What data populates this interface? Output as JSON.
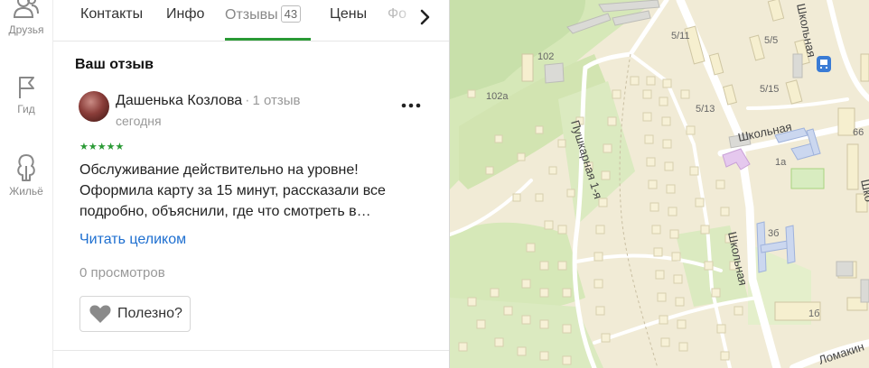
{
  "sidebar": {
    "items": [
      {
        "label": "Друзья",
        "icon": "friends-icon"
      },
      {
        "label": "Гид",
        "icon": "flag-icon"
      },
      {
        "label": "Жильё",
        "icon": "housing-icon"
      }
    ]
  },
  "tabs": [
    {
      "label": "Контакты"
    },
    {
      "label": "Инфо"
    },
    {
      "label": "Отзывы",
      "count": "43",
      "active": true
    },
    {
      "label": "Цены"
    },
    {
      "label": "Фо"
    }
  ],
  "review": {
    "section_title": "Ваш отзыв",
    "author": "Дашенька Козлова",
    "author_meta": "1 отзыв",
    "date": "сегодня",
    "rating": 5,
    "stars": "★★★★★",
    "text_lines": [
      "Обслуживание действительно на уровне!",
      "Оформила карту за 15 минут, рассказали все",
      "подробно, объяснили, где что смотреть в…"
    ],
    "read_more": "Читать целиком",
    "views": "0 просмотров",
    "useful_label": "Полезно?"
  },
  "map": {
    "streets": [
      {
        "id": "pushkarnaya",
        "label": "Пушкарная 1-я"
      },
      {
        "id": "shkolnaya-1",
        "label": "Школьная"
      },
      {
        "id": "shkolnaya-2",
        "label": "Школьная"
      },
      {
        "id": "shkolnaya-3",
        "label": "Школьная"
      },
      {
        "id": "shkolnaya-4",
        "label": "Шко"
      },
      {
        "id": "lomakina",
        "label": "Ломакин"
      }
    ],
    "buildings": [
      "102",
      "102а",
      "5/11",
      "5/5",
      "5/15",
      "5/13",
      "1а",
      "3б",
      "1б",
      "66"
    ],
    "colors": {
      "base": "#f1ebd6",
      "green": "#d6e8b8",
      "dark_green": "#c4deaa",
      "road": "#ffffff",
      "house": "#f7f1d7",
      "house_stroke": "#d7cfae",
      "purple": "#e5c8ee",
      "blue": "#cbd7ef",
      "gray": "#dadad6"
    }
  }
}
